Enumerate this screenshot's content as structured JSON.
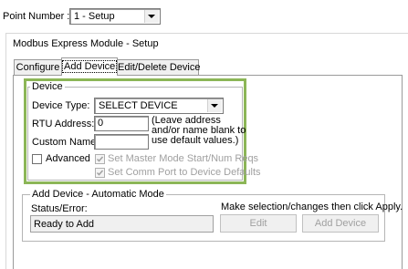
{
  "header": {
    "point_number_label": "Point Number :",
    "point_number_value": "1 - Setup"
  },
  "module_title": "Modbus Express Module - Setup",
  "tabs": [
    {
      "label": "Configure"
    },
    {
      "label": "Add Device"
    },
    {
      "label": "Edit/Delete Device"
    }
  ],
  "device_group": {
    "legend": "Device",
    "device_type_label": "Device Type:",
    "device_type_value": "SELECT DEVICE",
    "rtu_address_label": "RTU Address:",
    "rtu_address_value": "0",
    "custom_name_label": "Custom Name:",
    "custom_name_value": "",
    "hint_line1": "(Leave address",
    "hint_line2": "and/or name blank to",
    "hint_line3": "use default values.)",
    "advanced_label": "Advanced",
    "set_master_label": "Set Master Mode Start/Num Reqs",
    "set_comm_label": "Set Comm Port to Device Defaults"
  },
  "auto_group": {
    "legend": "Add Device - Automatic Mode",
    "status_label": "Status/Error:",
    "instruction": "Make selection/changes then click Apply.",
    "status_value": "Ready to Add",
    "edit_button": "Edit",
    "add_button": "Add Device"
  },
  "colors": {
    "highlight_border": "#8cb657",
    "disabled_text": "#a0a0a0"
  }
}
